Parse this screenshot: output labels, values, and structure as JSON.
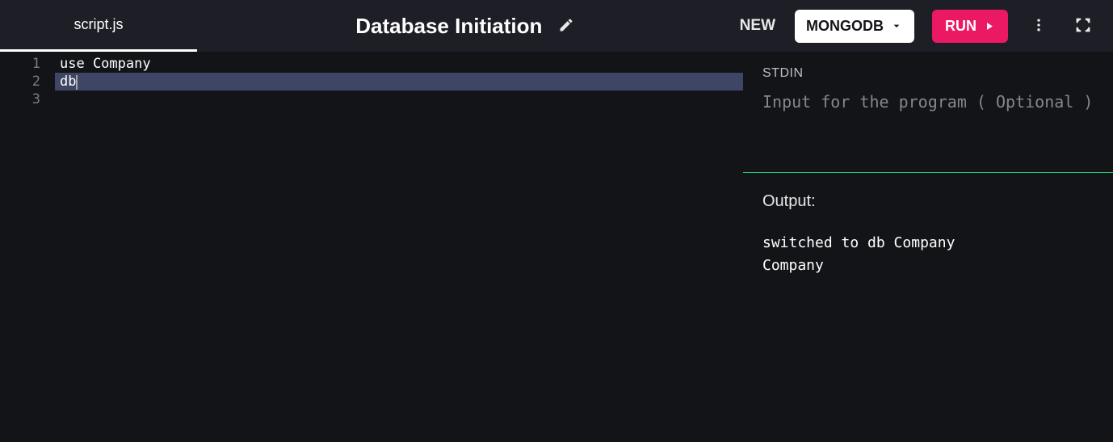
{
  "tab": {
    "filename": "script.js"
  },
  "title": "Database Initiation",
  "toolbar": {
    "new_label": "NEW",
    "language": "MONGODB",
    "run_label": "RUN"
  },
  "editor": {
    "lines": [
      {
        "num": "1",
        "text": "use Company",
        "active": false
      },
      {
        "num": "2",
        "text": "db",
        "active": true
      },
      {
        "num": "3",
        "text": "",
        "active": false
      }
    ]
  },
  "stdin": {
    "label": "STDIN",
    "placeholder": "Input for the program ( Optional )",
    "value": ""
  },
  "output": {
    "label": "Output:",
    "text": "switched to db Company\nCompany"
  }
}
